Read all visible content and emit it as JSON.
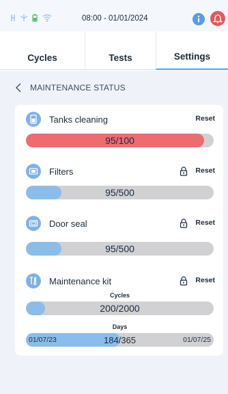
{
  "status_bar": {
    "icons": [
      "usb-icon",
      "psi-icon",
      "battery-icon",
      "wifi-icon"
    ],
    "datetime": "08:00 - 01/01/2024",
    "info_icon": "info-icon",
    "alarm_icon": "bell-icon",
    "colors": {
      "accent": "#5a9ce8",
      "alarm": "#e8565c",
      "battery": "#45b85a",
      "icons": "#8fbce4"
    }
  },
  "tabs": [
    {
      "label": "Cycles",
      "active": false
    },
    {
      "label": "Tests",
      "active": false
    },
    {
      "label": "Settings",
      "active": true
    }
  ],
  "page": {
    "back_icon": "chevron-left-icon",
    "title": "MAINTENANCE STATUS"
  },
  "items": [
    {
      "label": "Tanks cleaning",
      "icon": "tank-icon",
      "locked": false,
      "reset": "Reset",
      "bar": {
        "text": "95/100",
        "fraction": 0.95,
        "color": "#ee6b6f"
      }
    },
    {
      "label": "Filters",
      "icon": "filter-icon",
      "locked": true,
      "reset": "Reset",
      "bar": {
        "text": "95/500",
        "fraction": 0.19,
        "color": "#8bbdea"
      }
    },
    {
      "label": "Door seal",
      "icon": "door-seal-icon",
      "locked": true,
      "reset": "Reset",
      "bar": {
        "text": "95/500",
        "fraction": 0.19,
        "color": "#8bbdea"
      }
    },
    {
      "label": "Maintenance kit",
      "icon": "tools-icon",
      "locked": true,
      "reset": "Reset",
      "cycles_label": "Cycles",
      "bar": {
        "text": "200/2000",
        "fraction": 0.1,
        "color": "#8bbdea"
      },
      "days_label": "Days",
      "days_bar": {
        "start": "01/07/23",
        "value": "184",
        "total": "/365",
        "end": "01/07/25",
        "fraction": 0.5,
        "color": "#8bbdea"
      }
    }
  ]
}
